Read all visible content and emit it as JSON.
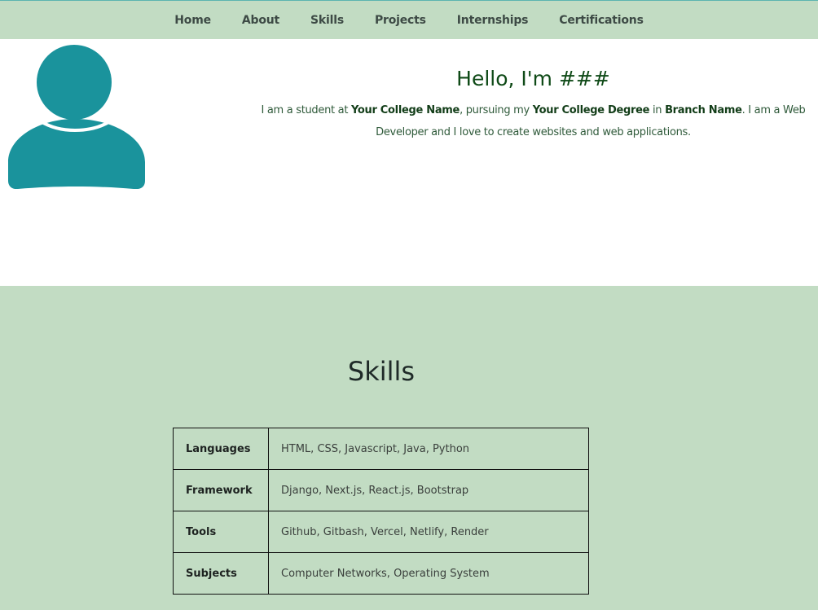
{
  "nav": {
    "items": [
      {
        "label": "Home"
      },
      {
        "label": "About"
      },
      {
        "label": "Skills"
      },
      {
        "label": "Projects"
      },
      {
        "label": "Internships"
      },
      {
        "label": "Certifications"
      }
    ]
  },
  "hero": {
    "title": "Hello, I'm ###",
    "desc_part1": "I am a student at ",
    "college_name": "Your College Name",
    "desc_part2": ", pursuing my ",
    "college_degree": "Your College Degree",
    "desc_part3": " in ",
    "branch_name": "Branch Name",
    "desc_part4": ". I am a Web Developer and I love to create websites and web applications.",
    "avatar_icon": "user-avatar-icon",
    "avatar_color": "#1a939c"
  },
  "skills": {
    "title": "Skills",
    "rows": [
      {
        "category": "Languages",
        "items": "HTML, CSS, Javascript, Java, Python"
      },
      {
        "category": "Framework",
        "items": "Django, Next.js, React.js, Bootstrap"
      },
      {
        "category": "Tools",
        "items": "Github, Gitbash, Vercel, Netlify, Render"
      },
      {
        "category": "Subjects",
        "items": "Computer Networks, Operating System"
      }
    ]
  },
  "colors": {
    "mint_background": "#c2dcc3",
    "heading_green": "#0f4a17",
    "accent_teal": "#1a939c"
  }
}
